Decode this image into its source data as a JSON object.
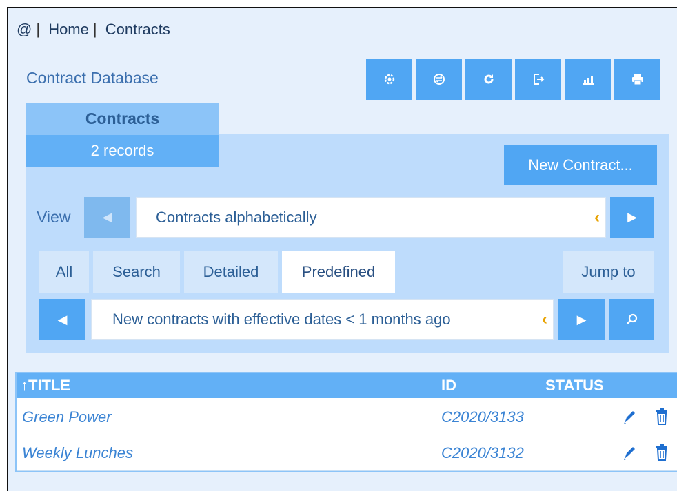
{
  "breadcrumb": {
    "root": "@",
    "home": "Home",
    "current": "Contracts"
  },
  "db_title": "Contract Database",
  "toolbar": [
    {
      "icon": "gear-icon"
    },
    {
      "icon": "switch-icon"
    },
    {
      "icon": "refresh-icon"
    },
    {
      "icon": "logout-icon"
    },
    {
      "icon": "chart-icon"
    },
    {
      "icon": "print-icon"
    }
  ],
  "table_tab": {
    "name": "Contracts",
    "count": "2 records"
  },
  "new_button": "New Contract...",
  "view": {
    "label": "View",
    "selected": "Contracts alphabetically"
  },
  "tabs": {
    "all": "All",
    "search": "Search",
    "detailed": "Detailed",
    "predefined": "Predefined",
    "jump_to": "Jump to"
  },
  "filter": {
    "selected": "New contracts with effective dates < 1 months ago"
  },
  "grid": {
    "columns": {
      "title": "↑TITLE",
      "id": "ID",
      "status": "STATUS"
    },
    "rows": [
      {
        "title": "Green Power",
        "id": "C2020/3133"
      },
      {
        "title": "Weekly Lunches",
        "id": "C2020/3132"
      }
    ]
  },
  "colors": {
    "accent": "#50a6f3",
    "panel": "#bedcfc",
    "background": "#e6f0fc",
    "chevron": "#e8a200"
  }
}
